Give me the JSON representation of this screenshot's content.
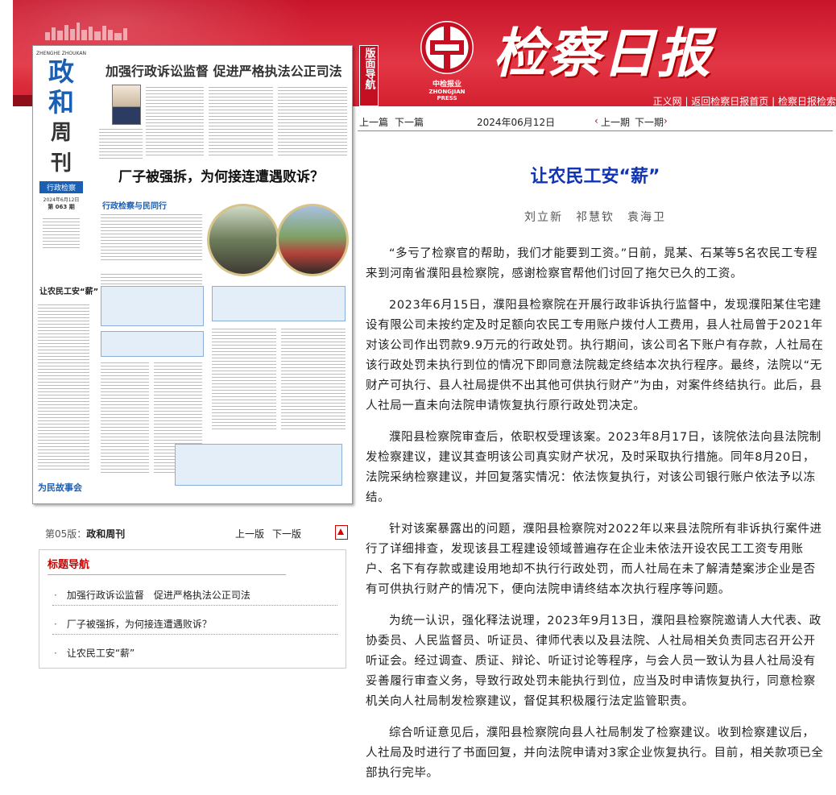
{
  "header": {
    "masthead": "检察日报",
    "logo_caption": "ZHONGJIAN PRESS",
    "logo_text": "中检报业",
    "banmian_nav": "版面导航",
    "links": [
      "正义网",
      "返回检察日报首页",
      "检察日报检索"
    ]
  },
  "newspaper_page": {
    "brand": "政和周刊",
    "brand_chars": [
      "政",
      "和",
      "周",
      "刊"
    ],
    "brand_pinyin": "ZHENGHE ZHOUKAN",
    "section_tag": "行政检察",
    "issue_date": "2024年6月12日",
    "issue_no": "第 063 期",
    "headline_top": "加强行政诉讼监督 促进严格执法公正司法",
    "headline_mid": "厂子被强拆，为何接连遭遇败诉？",
    "sub_section": "行政检察与民同行",
    "left_column_title": "让农民工安“薪”",
    "footer_tag": "为民故事会"
  },
  "page_nav": {
    "page_label": "第05版：",
    "page_name": "政和周刊",
    "prev": "上一版",
    "next": "下一版"
  },
  "title_nav": {
    "heading": "标题导航",
    "items": [
      "加强行政诉讼监督　促进严格执法公正司法",
      "厂子被强拆，为何接连遭遇败诉？",
      "让农民工安“薪”"
    ]
  },
  "toolbar": {
    "prev_article": "上一篇",
    "next_article": "下一篇",
    "date": "2024年06月12日",
    "prev_issue": "上一期",
    "next_issue": "下一期"
  },
  "article": {
    "title": "让农民工安“薪”",
    "authors": "刘立新　祁慧钦　袁海卫",
    "paragraphs": [
      "“多亏了检察官的帮助，我们才能要到工资。”日前，晁某、石某等5名农民工专程来到河南省濮阳县检察院，感谢检察官帮他们讨回了拖欠已久的工资。",
      "2023年6月15日，濮阳县检察院在开展行政非诉执行监督中，发现濮阳某住宅建设有限公司未按约定及时足额向农民工专用账户拨付人工费用，县人社局曾于2021年对该公司作出罚款9.9万元的行政处罚。执行期间，该公司名下账户有存款，人社局在该行政处罚未执行到位的情况下即同意法院裁定终结本次执行程序。最终，法院以“无财产可执行、县人社局提供不出其他可供执行财产”为由，对案件终结执行。此后，县人社局一直未向法院申请恢复执行原行政处罚决定。",
      "濮阳县检察院审查后，依职权受理该案。2023年8月17日，该院依法向县法院制发检察建议，建议其查明该公司真实财产状况，及时采取执行措施。同年8月20日，法院采纳检察建议，并回复落实情况：依法恢复执行，对该公司银行账户依法予以冻结。",
      "针对该案暴露出的问题，濮阳县检察院对2022年以来县法院所有非诉执行案件进行了详细排查，发现该县工程建设领域普遍存在企业未依法开设农民工工资专用账户、名下有存款或建设用地却不执行行政处罚，而人社局在未了解清楚案涉企业是否有可供执行财产的情况下，便向法院申请终结本次执行程序等问题。",
      "为统一认识，强化释法说理，2023年9月13日，濮阳县检察院邀请人大代表、政协委员、人民监督员、听证员、律师代表以及县法院、人社局相关负责同志召开公开听证会。经过调查、质证、辩论、听证讨论等程序，与会人员一致认为县人社局没有妥善履行审查义务，导致行政处罚未能执行到位，应当及时申请恢复执行，同意检察机关向人社局制发检察建议，督促其积极履行法定监管职责。",
      "综合听证意见后，濮阳县检察院向县人社局制发了检察建议。收到检察建议后，人社局及时进行了书面回复，并向法院申请对3家企业恢复执行。目前，相关款项已全部执行完毕。"
    ]
  },
  "colors": {
    "header_red": "#d4202f",
    "title_blue": "#1034b4",
    "nav_red": "#cc0000"
  }
}
